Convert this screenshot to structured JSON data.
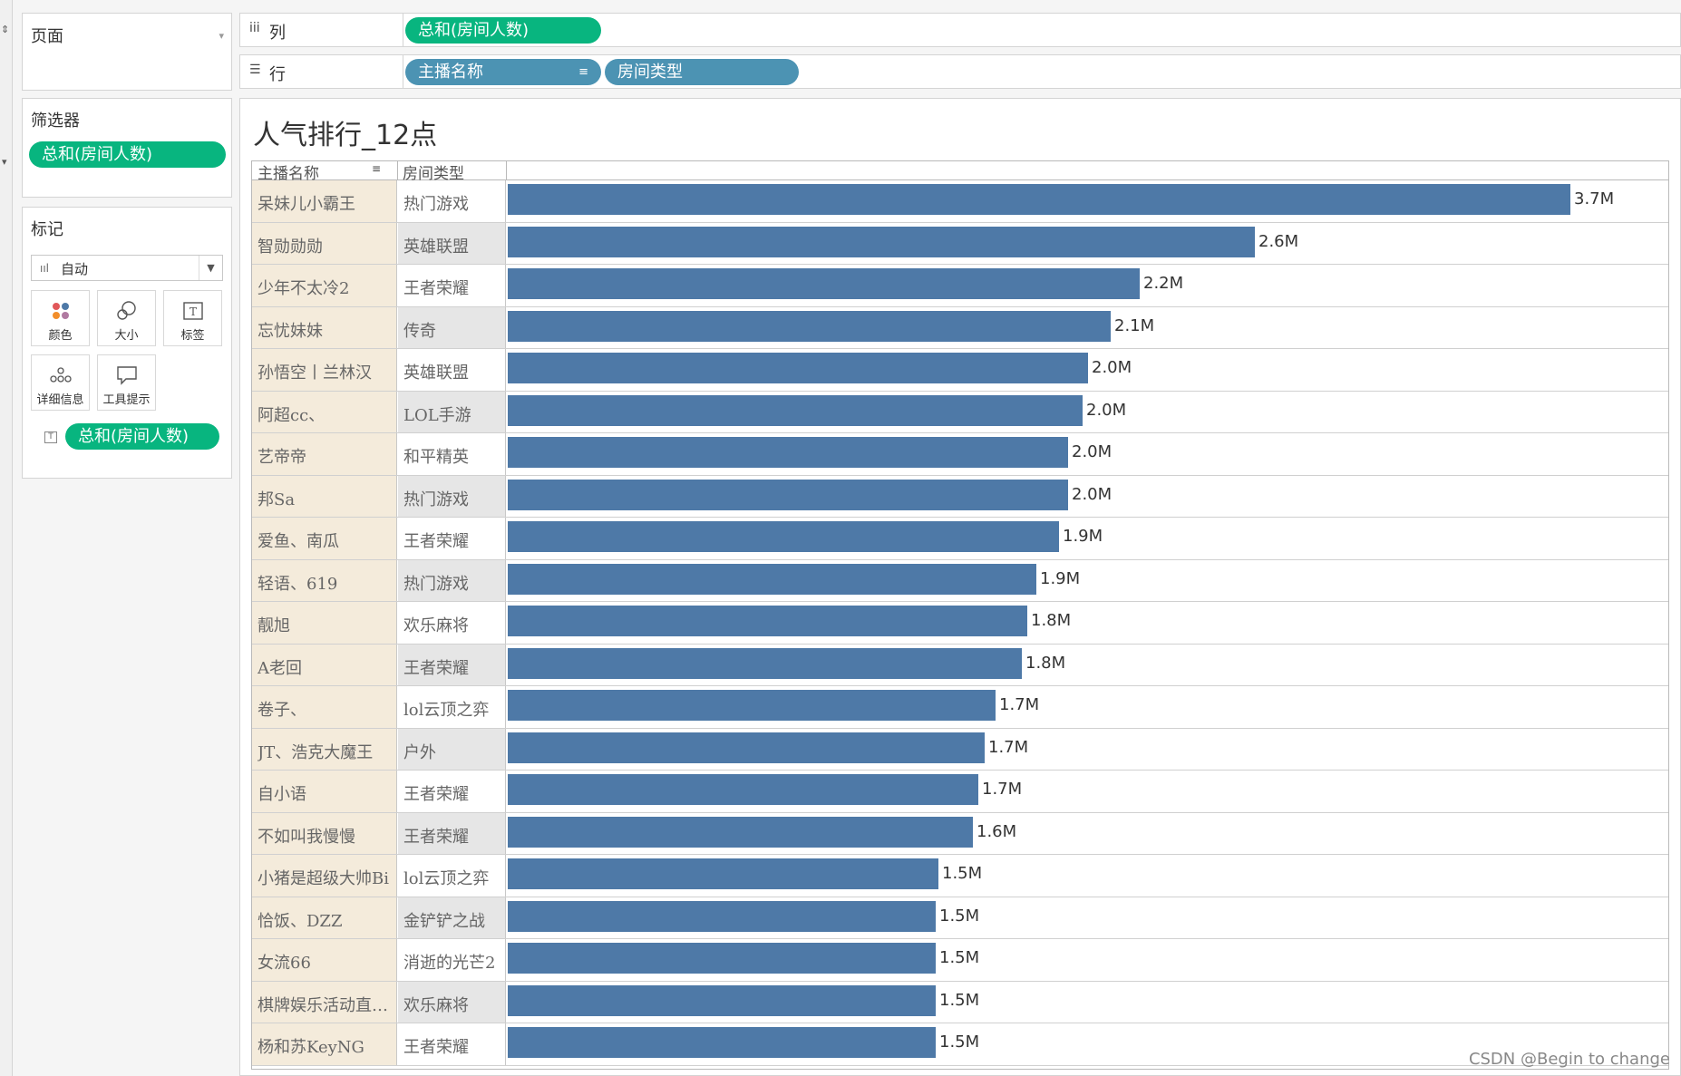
{
  "pages_panel": {
    "title": "页面"
  },
  "filters_panel": {
    "title": "筛选器",
    "pill": "总和(房间人数)"
  },
  "marks_panel": {
    "title": "标记",
    "mark_type": "自动",
    "buttons": [
      "颜色",
      "大小",
      "标签",
      "详细信息",
      "工具提示"
    ],
    "pill": "总和(房间人数)"
  },
  "shelves": {
    "columns_label": "列",
    "columns_pill": "总和(房间人数)",
    "rows_label": "行",
    "rows_pills": [
      "主播名称",
      "房间类型"
    ]
  },
  "view": {
    "title": "人气排行_12点",
    "header_col1": "主播名称",
    "header_col2": "房间类型"
  },
  "chart_data": {
    "type": "bar",
    "title": "人气排行_12点",
    "orientation": "horizontal",
    "xmax": 3.7,
    "rows": [
      {
        "anchor": "呆妹儿小霸王",
        "room": "热门游戏",
        "value": 3.7,
        "label": "3.7M"
      },
      {
        "anchor": "智勋勋勋",
        "room": "英雄联盟",
        "value": 2.6,
        "label": "2.6M"
      },
      {
        "anchor": "少年不太冷2",
        "room": "王者荣耀",
        "value": 2.2,
        "label": "2.2M"
      },
      {
        "anchor": "忘忧妹妹",
        "room": "传奇",
        "value": 2.1,
        "label": "2.1M"
      },
      {
        "anchor": "孙悟空丨兰林汉",
        "room": "英雄联盟",
        "value": 2.02,
        "label": "2.0M"
      },
      {
        "anchor": "阿超cc、",
        "room": "LOL手游",
        "value": 2.0,
        "label": "2.0M"
      },
      {
        "anchor": "艺帝帝",
        "room": "和平精英",
        "value": 1.95,
        "label": "2.0M"
      },
      {
        "anchor": "邦Sa",
        "room": "热门游戏",
        "value": 1.95,
        "label": "2.0M"
      },
      {
        "anchor": "爱鱼、南瓜",
        "room": "王者荣耀",
        "value": 1.92,
        "label": "1.9M"
      },
      {
        "anchor": "轻语、619",
        "room": "热门游戏",
        "value": 1.84,
        "label": "1.9M"
      },
      {
        "anchor": "靓旭",
        "room": "欢乐麻将",
        "value": 1.81,
        "label": "1.8M"
      },
      {
        "anchor": "A老回",
        "room": "王者荣耀",
        "value": 1.79,
        "label": "1.8M"
      },
      {
        "anchor": "卷子、",
        "room": "lol云顶之弈",
        "value": 1.7,
        "label": "1.7M"
      },
      {
        "anchor": "JT、浩克大魔王",
        "room": "户外",
        "value": 1.66,
        "label": "1.7M"
      },
      {
        "anchor": "自小语",
        "room": "王者荣耀",
        "value": 1.64,
        "label": "1.7M"
      },
      {
        "anchor": "不如叫我慢慢",
        "room": "王者荣耀",
        "value": 1.62,
        "label": "1.6M"
      },
      {
        "anchor": "小猪是超级大帅Bi",
        "room": "lol云顶之弈",
        "value": 1.5,
        "label": "1.5M"
      },
      {
        "anchor": "恰饭、DZZ",
        "room": "金铲铲之战",
        "value": 1.49,
        "label": "1.5M"
      },
      {
        "anchor": "女流66",
        "room": "消逝的光芒2",
        "value": 1.49,
        "label": "1.5M"
      },
      {
        "anchor": "棋牌娱乐活动直播..",
        "room": "欢乐麻将",
        "value": 1.49,
        "label": "1.5M"
      },
      {
        "anchor": "杨和苏KeyNG",
        "room": "王者荣耀",
        "value": 1.49,
        "label": "1.5M"
      }
    ],
    "bar_color": "#4e79a7"
  },
  "watermark": "CSDN @Begin to change",
  "colors": {
    "pill_green": "#08b57f",
    "pill_blue": "#4c93b3",
    "bar": "#4e79a7",
    "row_header_bg": "#f4ebdb"
  }
}
